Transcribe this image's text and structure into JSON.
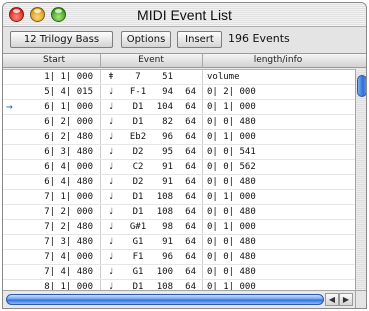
{
  "window": {
    "title": "MIDI Event List"
  },
  "toolbar": {
    "track_label": "12 Trilogy Bass",
    "options_label": "Options",
    "insert_label": "Insert",
    "event_count": "196 Events"
  },
  "columns": {
    "start": "Start",
    "event": "Event",
    "length": "length/info"
  },
  "rows": [
    {
      "arrow": "",
      "start": "1| 1| 000",
      "note_icon": "ǂ",
      "name": "7",
      "v1": "51",
      "v2": "",
      "info": "volume"
    },
    {
      "arrow": "",
      "start": "5| 4| 015",
      "note_icon": "♩",
      "name": "F-1",
      "v1": "94",
      "v2": "64",
      "info": "0| 2| 000"
    },
    {
      "arrow": "→",
      "start": "6| 1| 000",
      "note_icon": "♩",
      "name": "D1",
      "v1": "104",
      "v2": "64",
      "info": "0| 1| 000"
    },
    {
      "arrow": "",
      "start": "6| 2| 000",
      "note_icon": "♩",
      "name": "D1",
      "v1": "82",
      "v2": "64",
      "info": "0| 0| 480"
    },
    {
      "arrow": "",
      "start": "6| 2| 480",
      "note_icon": "♩",
      "name": "Eb2",
      "v1": "96",
      "v2": "64",
      "info": "0| 1| 000"
    },
    {
      "arrow": "",
      "start": "6| 3| 480",
      "note_icon": "♩",
      "name": "D2",
      "v1": "95",
      "v2": "64",
      "info": "0| 0| 541"
    },
    {
      "arrow": "",
      "start": "6| 4| 000",
      "note_icon": "♩",
      "name": "C2",
      "v1": "91",
      "v2": "64",
      "info": "0| 0| 562"
    },
    {
      "arrow": "",
      "start": "6| 4| 480",
      "note_icon": "♩",
      "name": "D2",
      "v1": "91",
      "v2": "64",
      "info": "0| 0| 480"
    },
    {
      "arrow": "",
      "start": "7| 1| 000",
      "note_icon": "♩",
      "name": "D1",
      "v1": "108",
      "v2": "64",
      "info": "0| 1| 000"
    },
    {
      "arrow": "",
      "start": "7| 2| 000",
      "note_icon": "♩",
      "name": "D1",
      "v1": "108",
      "v2": "64",
      "info": "0| 0| 480"
    },
    {
      "arrow": "",
      "start": "7| 2| 480",
      "note_icon": "♩",
      "name": "G#1",
      "v1": "98",
      "v2": "64",
      "info": "0| 1| 000"
    },
    {
      "arrow": "",
      "start": "7| 3| 480",
      "note_icon": "♩",
      "name": "G1",
      "v1": "91",
      "v2": "64",
      "info": "0| 0| 480"
    },
    {
      "arrow": "",
      "start": "7| 4| 000",
      "note_icon": "♩",
      "name": "F1",
      "v1": "96",
      "v2": "64",
      "info": "0| 0| 480"
    },
    {
      "arrow": "",
      "start": "7| 4| 480",
      "note_icon": "♩",
      "name": "G1",
      "v1": "100",
      "v2": "64",
      "info": "0| 0| 480"
    },
    {
      "arrow": "",
      "start": "8| 1| 000",
      "note_icon": "♩",
      "name": "D1",
      "v1": "108",
      "v2": "64",
      "info": "0| 1| 000"
    }
  ],
  "scroll": {
    "left_arrow": "◀",
    "right_arrow": "▶"
  }
}
